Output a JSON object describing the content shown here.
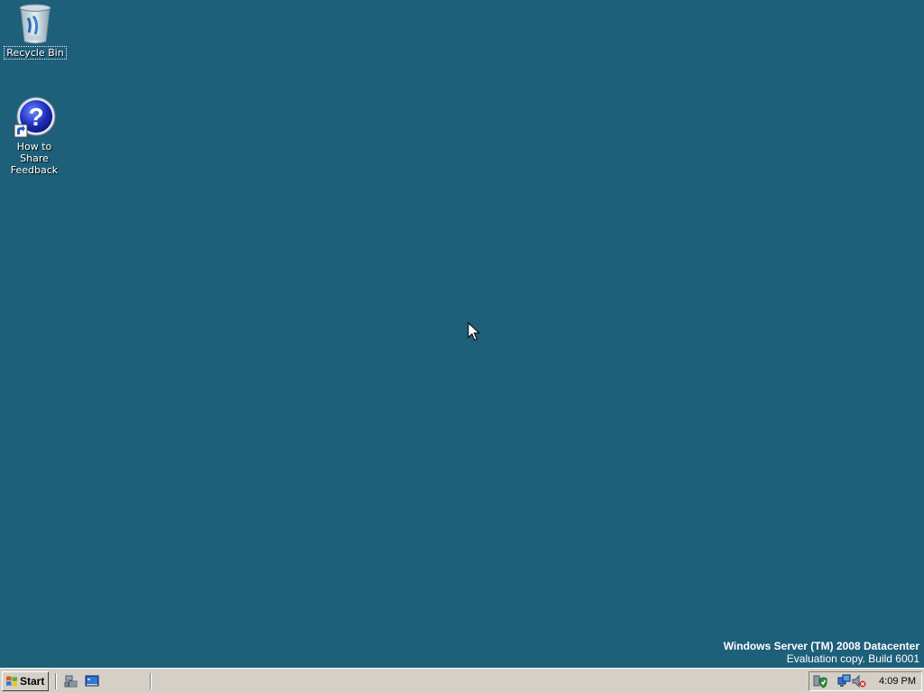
{
  "desktop": {
    "background_color": "#1e5f7a",
    "icons": [
      {
        "label": "Recycle Bin",
        "icon": "recycle-bin-icon"
      },
      {
        "label": "How to Share Feedback",
        "icon": "help-shortcut-icon"
      }
    ],
    "watermark": {
      "title": "Windows Server (TM) 2008 Datacenter",
      "subtitle": "Evaluation copy. Build 6001"
    }
  },
  "taskbar": {
    "start_label": "Start",
    "quick_launch": [
      {
        "icon": "server-manager-icon"
      },
      {
        "icon": "show-desktop-icon"
      }
    ],
    "tray": {
      "icons": [
        "security-shield-icon",
        "network-icon",
        "volume-muted-icon"
      ],
      "clock": "4:09 PM"
    }
  }
}
